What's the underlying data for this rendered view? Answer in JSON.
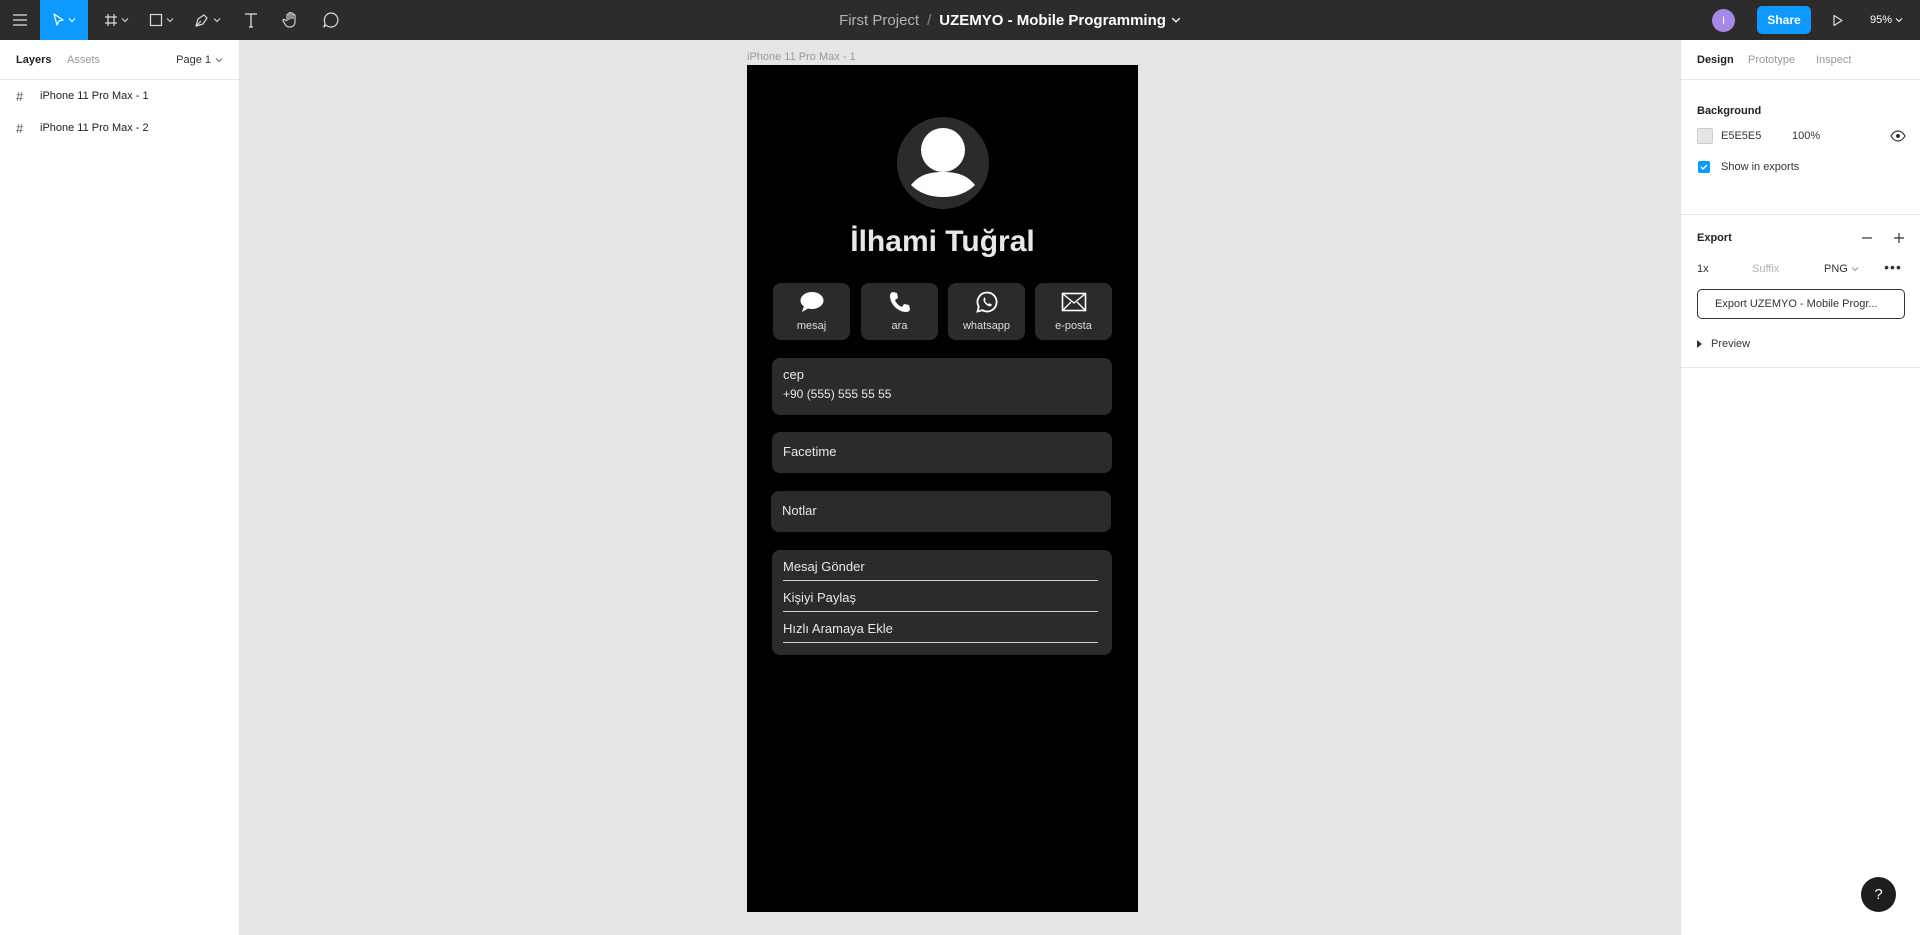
{
  "toolbar": {
    "menu_icon": "hamburger-menu-icon",
    "tools": [
      "move-tool",
      "frame-tool",
      "shape-tool",
      "pen-tool",
      "text-tool",
      "hand-tool",
      "comment-tool"
    ],
    "project_name": "First Project",
    "separator": "/",
    "file_name": "UZEMYO - Mobile Programming",
    "user_initial": "I",
    "share_label": "Share",
    "zoom_label": "95%"
  },
  "left_panel": {
    "tabs": {
      "layers": "Layers",
      "assets": "Assets"
    },
    "page_selector": "Page 1",
    "layers": [
      {
        "icon": "#",
        "name": "iPhone 11 Pro Max - 1"
      },
      {
        "icon": "#",
        "name": "iPhone 11 Pro Max - 2"
      }
    ]
  },
  "canvas": {
    "frame_label": "iPhone 11 Pro Max - 1",
    "contact": {
      "name": "İlhami Tuğral",
      "actions": [
        {
          "label": "mesaj",
          "icon": "message-bubble-icon"
        },
        {
          "label": "ara",
          "icon": "phone-icon"
        },
        {
          "label": "whatsapp",
          "icon": "whatsapp-icon"
        },
        {
          "label": "e-posta",
          "icon": "envelope-icon"
        }
      ],
      "phone_label": "cep",
      "phone_number": "+90 (555) 555 55 55",
      "facetime": "Facetime",
      "notes": "Notlar",
      "action_list": [
        "Mesaj Gönder",
        "Kişiyi Paylaş",
        "Hızlı Aramaya Ekle"
      ]
    }
  },
  "right_panel": {
    "tabs": {
      "design": "Design",
      "prototype": "Prototype",
      "inspect": "Inspect"
    },
    "background": {
      "title": "Background",
      "hex": "E5E5E5",
      "color": "#E5E5E5",
      "opacity": "100%",
      "show_in_exports": "Show in exports"
    },
    "export": {
      "title": "Export",
      "scale": "1x",
      "suffix_placeholder": "Suffix",
      "format": "PNG",
      "more": "•••",
      "button": "Export UZEMYO - Mobile Progr...",
      "preview": "Preview"
    }
  },
  "help_label": "?",
  "colors": {
    "accent": "#0d99ff",
    "toolbar_bg": "#2c2c2c",
    "canvas_bg": "#e5e5e5",
    "phone_bg": "#000000",
    "card_bg": "#2b2b2b"
  }
}
